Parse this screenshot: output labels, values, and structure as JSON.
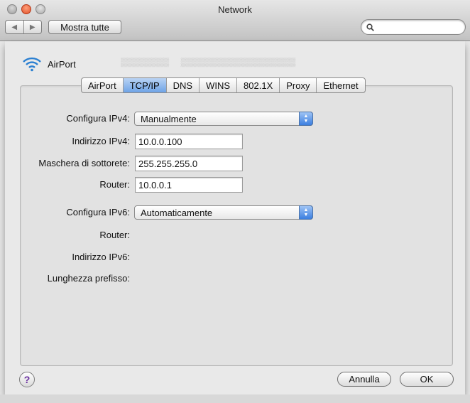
{
  "window": {
    "title": "Network"
  },
  "toolbar": {
    "back_icon": "back-icon",
    "forward_icon": "forward-icon",
    "show_all_label": "Mostra tutte",
    "search_placeholder": ""
  },
  "sheet": {
    "interface_name": "AirPort",
    "tabs": [
      {
        "label": "AirPort",
        "selected": false
      },
      {
        "label": "TCP/IP",
        "selected": true
      },
      {
        "label": "DNS",
        "selected": false
      },
      {
        "label": "WINS",
        "selected": false
      },
      {
        "label": "802.1X",
        "selected": false
      },
      {
        "label": "Proxy",
        "selected": false
      },
      {
        "label": "Ethernet",
        "selected": false
      }
    ],
    "ipv4": {
      "configure_label": "Configura IPv4:",
      "configure_value": "Manualmente",
      "address_label": "Indirizzo IPv4:",
      "address_value": "10.0.0.100",
      "subnet_label": "Maschera di sottorete:",
      "subnet_value": "255.255.255.0",
      "router_label": "Router:",
      "router_value": "10.0.0.1"
    },
    "ipv6": {
      "configure_label": "Configura IPv6:",
      "configure_value": "Automaticamente",
      "router_label": "Router:",
      "address_label": "Indirizzo IPv6:",
      "prefix_label": "Lunghezza prefisso:"
    },
    "help_label": "?",
    "cancel_label": "Annulla",
    "ok_label": "OK"
  },
  "colors": {
    "selected_tab": "#6ea3e6",
    "popup_stepper": "#3c7fe0",
    "help_glyph": "#6a2fa0"
  }
}
